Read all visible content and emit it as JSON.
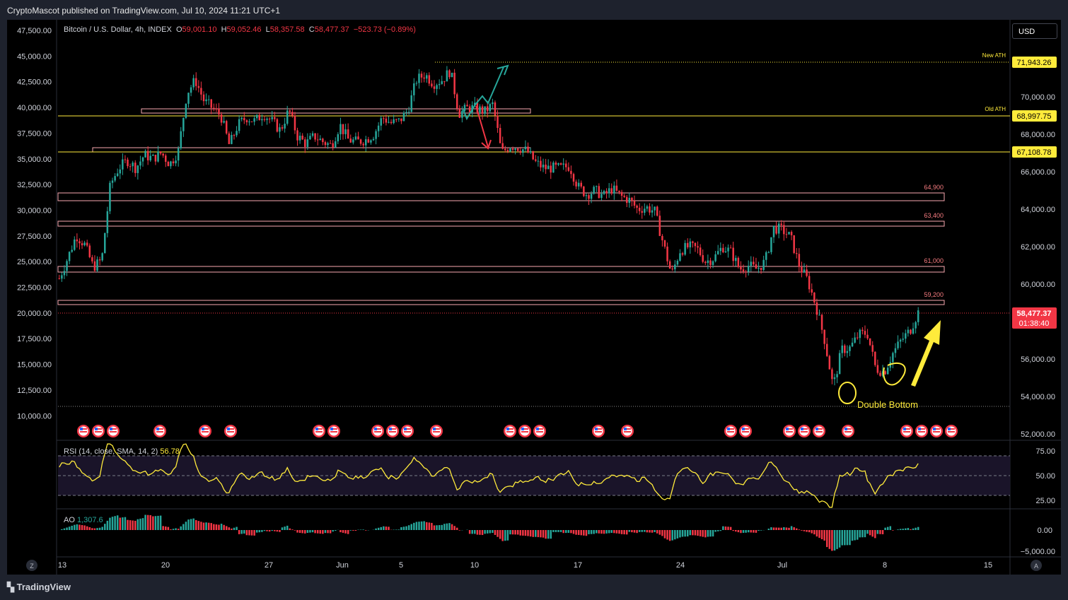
{
  "header": {
    "published": "CryptoMascot published on TradingView.com, Jul 10, 2024 11:21 UTC+1"
  },
  "footer": {
    "brand": "TradingView"
  },
  "legend": {
    "symbol": "Bitcoin / U.S. Dollar, 4h, INDEX",
    "o_label": "O",
    "o": "59,001.10",
    "h_label": "H",
    "h": "59,052.46",
    "l_label": "L",
    "l": "58,357.58",
    "c_label": "C",
    "c": "58,477.37",
    "change": "−523.73 (−0.89%)"
  },
  "currency_button": "USD",
  "rsi": {
    "label": "RSI (14, close, SMA, 14, 2)",
    "value": "56.78"
  },
  "ao": {
    "label": "AO",
    "value": "1,307.6"
  },
  "corner_left": "Z",
  "corner_right": "A",
  "colors": {
    "up": "#26a69a",
    "down": "#f23645",
    "annotation": "#ffeb3b",
    "zone": "#f7a8b0",
    "background": "#000000"
  },
  "chart_data": {
    "type": "candlestick",
    "timeframe": "4h",
    "left_axis": [
      "47,500.00",
      "45,000.00",
      "42,500.00",
      "40,000.00",
      "37,500.00",
      "35,000.00",
      "32,500.00",
      "30,000.00",
      "27,500.00",
      "25,000.00",
      "22,500.00",
      "20,000.00",
      "17,500.00",
      "15,000.00",
      "12,500.00",
      "10,000.00"
    ],
    "right_axis": [
      "70,000.00",
      "68,000.00",
      "66,000.00",
      "64,000.00",
      "62,000.00",
      "60,000.00",
      "56,000.00",
      "54,000.00",
      "52,000.00"
    ],
    "x_ticks": [
      "13",
      "20",
      "27",
      "Jun",
      "5",
      "10",
      "17",
      "24",
      "Jul",
      "8",
      "15"
    ],
    "last_price": "58,477.37",
    "countdown": "01:38:40",
    "levels": [
      {
        "label": "New ATH",
        "value": "71,943.26"
      },
      {
        "label": "Old ATH",
        "value": "68,997.75"
      },
      {
        "label": "",
        "value": "67,108.78"
      }
    ],
    "zones": [
      "64,900",
      "63,400",
      "61,000",
      "59,200"
    ],
    "annotations": [
      "Double Bottom"
    ],
    "close_path": [
      [
        0,
        60300
      ],
      [
        1,
        61400
      ],
      [
        2,
        62600
      ],
      [
        3,
        62100
      ],
      [
        4,
        60900
      ],
      [
        5,
        61300
      ],
      [
        6,
        65300
      ],
      [
        7,
        66200
      ],
      [
        8,
        66600
      ],
      [
        9,
        66200
      ],
      [
        10,
        66900
      ],
      [
        11,
        66700
      ],
      [
        12,
        67000
      ],
      [
        13,
        66400
      ],
      [
        14,
        67100
      ],
      [
        15,
        70200
      ],
      [
        16,
        70900
      ],
      [
        17,
        69800
      ],
      [
        18,
        69400
      ],
      [
        19,
        69000
      ],
      [
        20,
        67400
      ],
      [
        21,
        68500
      ],
      [
        22,
        68900
      ],
      [
        23,
        68700
      ],
      [
        24,
        69100
      ],
      [
        25,
        68700
      ],
      [
        26,
        68200
      ],
      [
        27,
        69300
      ],
      [
        28,
        67900
      ],
      [
        29,
        67500
      ],
      [
        30,
        67900
      ],
      [
        31,
        67600
      ],
      [
        32,
        67400
      ],
      [
        33,
        68500
      ],
      [
        34,
        67700
      ],
      [
        35,
        67600
      ],
      [
        36,
        67700
      ],
      [
        37,
        68000
      ],
      [
        38,
        68900
      ],
      [
        39,
        68600
      ],
      [
        40,
        68700
      ],
      [
        41,
        69300
      ],
      [
        42,
        70900
      ],
      [
        43,
        71200
      ],
      [
        44,
        70700
      ],
      [
        45,
        70900
      ],
      [
        46,
        71400
      ],
      [
        47,
        69100
      ],
      [
        48,
        69400
      ],
      [
        49,
        69400
      ],
      [
        50,
        69200
      ],
      [
        51,
        69600
      ],
      [
        52,
        67000
      ],
      [
        53,
        67400
      ],
      [
        54,
        67300
      ],
      [
        55,
        67100
      ],
      [
        56,
        66500
      ],
      [
        57,
        66200
      ],
      [
        58,
        66200
      ],
      [
        59,
        66200
      ],
      [
        60,
        66300
      ],
      [
        61,
        65200
      ],
      [
        62,
        64800
      ],
      [
        63,
        65000
      ],
      [
        64,
        64700
      ],
      [
        65,
        65100
      ],
      [
        66,
        64700
      ],
      [
        67,
        64500
      ],
      [
        68,
        64000
      ],
      [
        69,
        64100
      ],
      [
        70,
        63900
      ],
      [
        71,
        62200
      ],
      [
        72,
        60500
      ],
      [
        73,
        61800
      ],
      [
        74,
        62000
      ],
      [
        75,
        61900
      ],
      [
        76,
        61200
      ],
      [
        77,
        61400
      ],
      [
        78,
        62000
      ],
      [
        79,
        61700
      ],
      [
        80,
        60800
      ],
      [
        81,
        61000
      ],
      [
        82,
        60800
      ],
      [
        83,
        61200
      ],
      [
        84,
        63000
      ],
      [
        85,
        62900
      ],
      [
        86,
        62500
      ],
      [
        87,
        61000
      ],
      [
        88,
        60200
      ],
      [
        89,
        58800
      ],
      [
        90,
        57000
      ],
      [
        91,
        54500
      ],
      [
        92,
        56500
      ],
      [
        93,
        56600
      ],
      [
        94,
        57300
      ],
      [
        95,
        57400
      ],
      [
        96,
        55500
      ],
      [
        97,
        55300
      ],
      [
        98,
        56300
      ],
      [
        99,
        57000
      ],
      [
        100,
        57500
      ],
      [
        101,
        58500
      ]
    ]
  }
}
